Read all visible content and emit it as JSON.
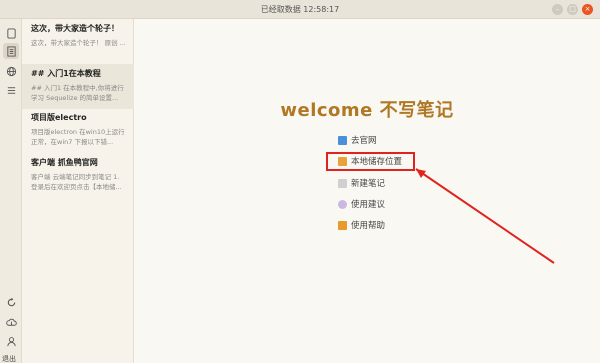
{
  "window": {
    "title": "已经取数据 12:58:17"
  },
  "iconbar": {
    "top_icons": [
      "file-icon",
      "notebook-icon",
      "globe-icon",
      "list-icon"
    ],
    "bottom_icons": [
      "sync-icon",
      "upload-icon",
      "user-icon"
    ],
    "exit_label": "退出"
  },
  "notes": [
    {
      "title": "这次，带大家造个轮子！",
      "snippet": "这次，带大家造个轮子！ 原创 ..."
    },
    {
      "title": "## 入门1在本教程",
      "snippet": "## 入门1 在本教程中,你将进行学习 Sequelize 的简单设置..."
    },
    {
      "title": "项目版electro",
      "snippet": "项目版electron 在win10上运行正常，在win7 下报以下错..."
    },
    {
      "title": "客户端 抓鱼鸭官网",
      "snippet": "客户端 云端笔记同步到笔记 1. 登录后在欢迎页点击【本地储..."
    }
  ],
  "main": {
    "welcome": "welcome  不写笔记",
    "menu": [
      {
        "label": "去官网",
        "icon": "website-icon",
        "color": "#4a90d9"
      },
      {
        "label": "本地储存位置",
        "icon": "folder-icon",
        "color": "#e8a23a"
      },
      {
        "label": "新建笔记",
        "icon": "new-note-icon",
        "color": "#bbbbbb"
      },
      {
        "label": "使用建议",
        "icon": "feedback-icon",
        "color": "#c9b8e0"
      },
      {
        "label": "使用帮助",
        "icon": "help-icon",
        "color": "#e89a2a"
      }
    ]
  },
  "colors": {
    "accent": "#b07824",
    "annotation": "#e0231c"
  }
}
